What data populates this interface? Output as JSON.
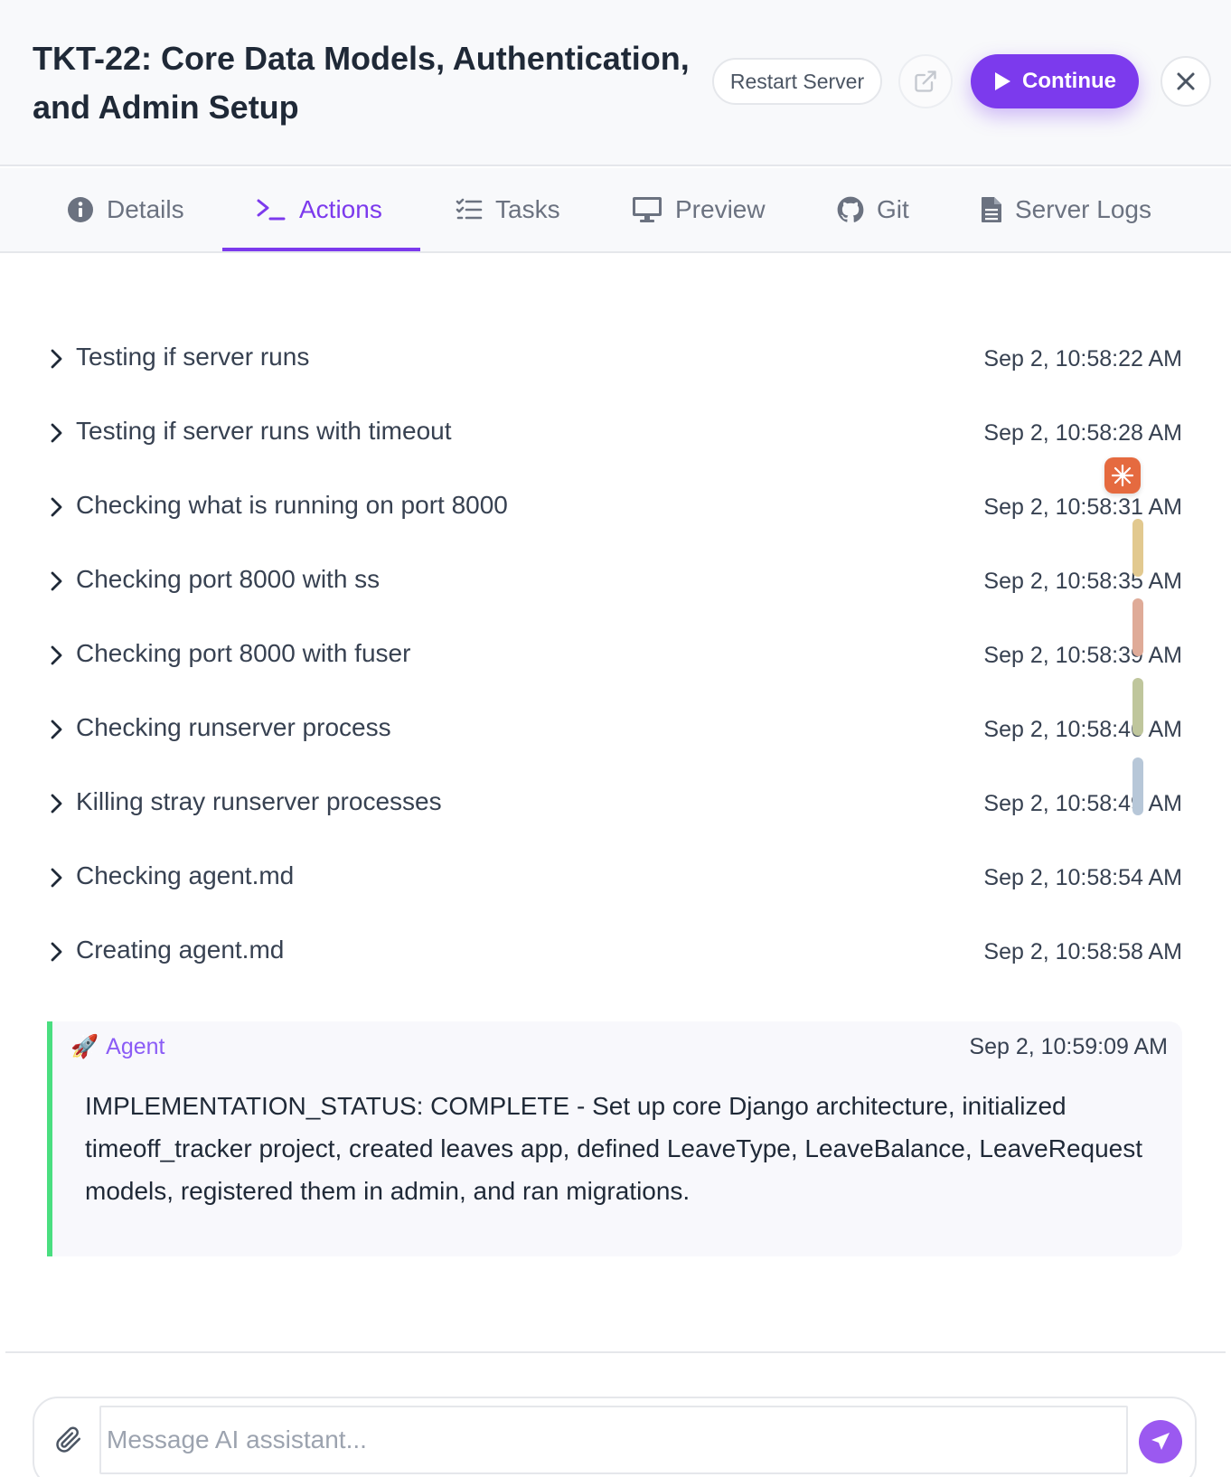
{
  "header": {
    "title": "TKT-22: Core Data Models, Authentication, and Admin Setup",
    "restart_label": "Restart Server",
    "continue_label": "Continue"
  },
  "tabs": [
    {
      "label": "Details",
      "icon": "info-icon"
    },
    {
      "label": "Actions",
      "icon": "terminal-icon",
      "active": true
    },
    {
      "label": "Tasks",
      "icon": "checklist-icon"
    },
    {
      "label": "Preview",
      "icon": "monitor-icon"
    },
    {
      "label": "Git",
      "icon": "github-icon"
    },
    {
      "label": "Server Logs",
      "icon": "document-icon"
    }
  ],
  "actions": [
    {
      "label": "Testing if server runs",
      "time": "Sep 2, 10:58:22 AM"
    },
    {
      "label": "Testing if server runs with timeout",
      "time": "Sep 2, 10:58:28 AM"
    },
    {
      "label": "Checking what is running on port 8000",
      "time": "Sep 2, 10:58:31 AM"
    },
    {
      "label": "Checking port 8000 with ss",
      "time": "Sep 2, 10:58:35 AM"
    },
    {
      "label": "Checking port 8000 with fuser",
      "time": "Sep 2, 10:58:39 AM"
    },
    {
      "label": "Checking runserver process",
      "time": "Sep 2, 10:58:46 AM"
    },
    {
      "label": "Killing stray runserver processes",
      "time": "Sep 2, 10:58:49 AM"
    },
    {
      "label": "Checking agent.md",
      "time": "Sep 2, 10:58:54 AM"
    },
    {
      "label": "Creating agent.md",
      "time": "Sep 2, 10:58:58 AM"
    }
  ],
  "agent": {
    "emoji": "🚀",
    "name": "Agent",
    "time": "Sep 2, 10:59:09 AM",
    "message": "IMPLEMENTATION_STATUS: COMPLETE - Set up core Django architecture, initialized timeoff_tracker project, created leaves app, defined LeaveType, LeaveBalance, LeaveRequest models, registered them in admin, and ran migrations."
  },
  "composer": {
    "placeholder": "Message AI assistant..."
  },
  "colors": {
    "accent": "#7c3aed",
    "agent_border": "#4ade80",
    "floating_badge": "#e56a3f",
    "pills": [
      "#e2c98f",
      "#dfab98",
      "#bfc69c",
      "#b7c7d8"
    ]
  }
}
